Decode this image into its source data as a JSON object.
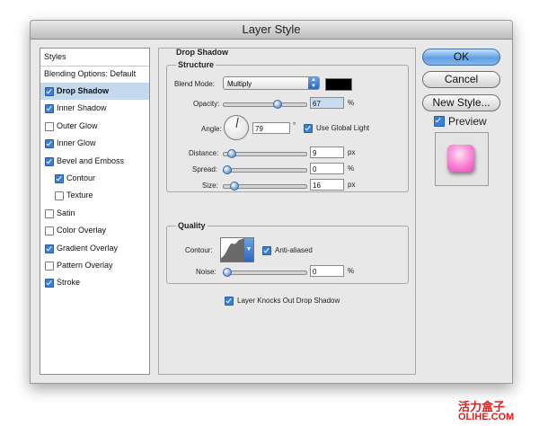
{
  "window": {
    "title": "Layer Style"
  },
  "styles_panel": {
    "header": "Styles",
    "blending": "Blending Options: Default",
    "items": [
      {
        "label": "Drop Shadow",
        "checked": true,
        "selected": true,
        "indent": 0
      },
      {
        "label": "Inner Shadow",
        "checked": true,
        "selected": false,
        "indent": 0
      },
      {
        "label": "Outer Glow",
        "checked": false,
        "selected": false,
        "indent": 0
      },
      {
        "label": "Inner Glow",
        "checked": true,
        "selected": false,
        "indent": 0
      },
      {
        "label": "Bevel and Emboss",
        "checked": true,
        "selected": false,
        "indent": 0
      },
      {
        "label": "Contour",
        "checked": true,
        "selected": false,
        "indent": 1
      },
      {
        "label": "Texture",
        "checked": false,
        "selected": false,
        "indent": 1
      },
      {
        "label": "Satin",
        "checked": false,
        "selected": false,
        "indent": 0
      },
      {
        "label": "Color Overlay",
        "checked": false,
        "selected": false,
        "indent": 0
      },
      {
        "label": "Gradient Overlay",
        "checked": true,
        "selected": false,
        "indent": 0
      },
      {
        "label": "Pattern Overlay",
        "checked": false,
        "selected": false,
        "indent": 0
      },
      {
        "label": "Stroke",
        "checked": true,
        "selected": false,
        "indent": 0
      }
    ]
  },
  "drop_shadow": {
    "title": "Drop Shadow",
    "structure": {
      "title": "Structure",
      "blend_mode_label": "Blend Mode:",
      "blend_mode_value": "Multiply",
      "shadow_color": "#000000",
      "opacity_label": "Opacity:",
      "opacity_value": "67",
      "opacity_unit": "%",
      "opacity_fraction": 0.67,
      "angle_label": "Angle:",
      "angle_value": "79",
      "angle_unit": "°",
      "angle_degrees": 79,
      "use_global_light_label": "Use Global Light",
      "use_global_light": true,
      "distance_label": "Distance:",
      "distance_value": "9",
      "distance_unit": "px",
      "distance_fraction": 0.06,
      "spread_label": "Spread:",
      "spread_value": "0",
      "spread_unit": "%",
      "spread_fraction": 0,
      "size_label": "Size:",
      "size_value": "16",
      "size_unit": "px",
      "size_fraction": 0.1
    },
    "quality": {
      "title": "Quality",
      "contour_label": "Contour:",
      "anti_aliased_label": "Anti-aliased",
      "anti_aliased": true,
      "noise_label": "Noise:",
      "noise_value": "0",
      "noise_unit": "%",
      "noise_fraction": 0
    },
    "knockout_label": "Layer Knocks Out Drop Shadow",
    "knockout": true
  },
  "buttons": {
    "ok": "OK",
    "cancel": "Cancel",
    "new_style": "New Style..."
  },
  "preview": {
    "label": "Preview",
    "checked": true
  },
  "watermark": {
    "cn": "活力盒子",
    "en": "OLIHE.COM"
  }
}
